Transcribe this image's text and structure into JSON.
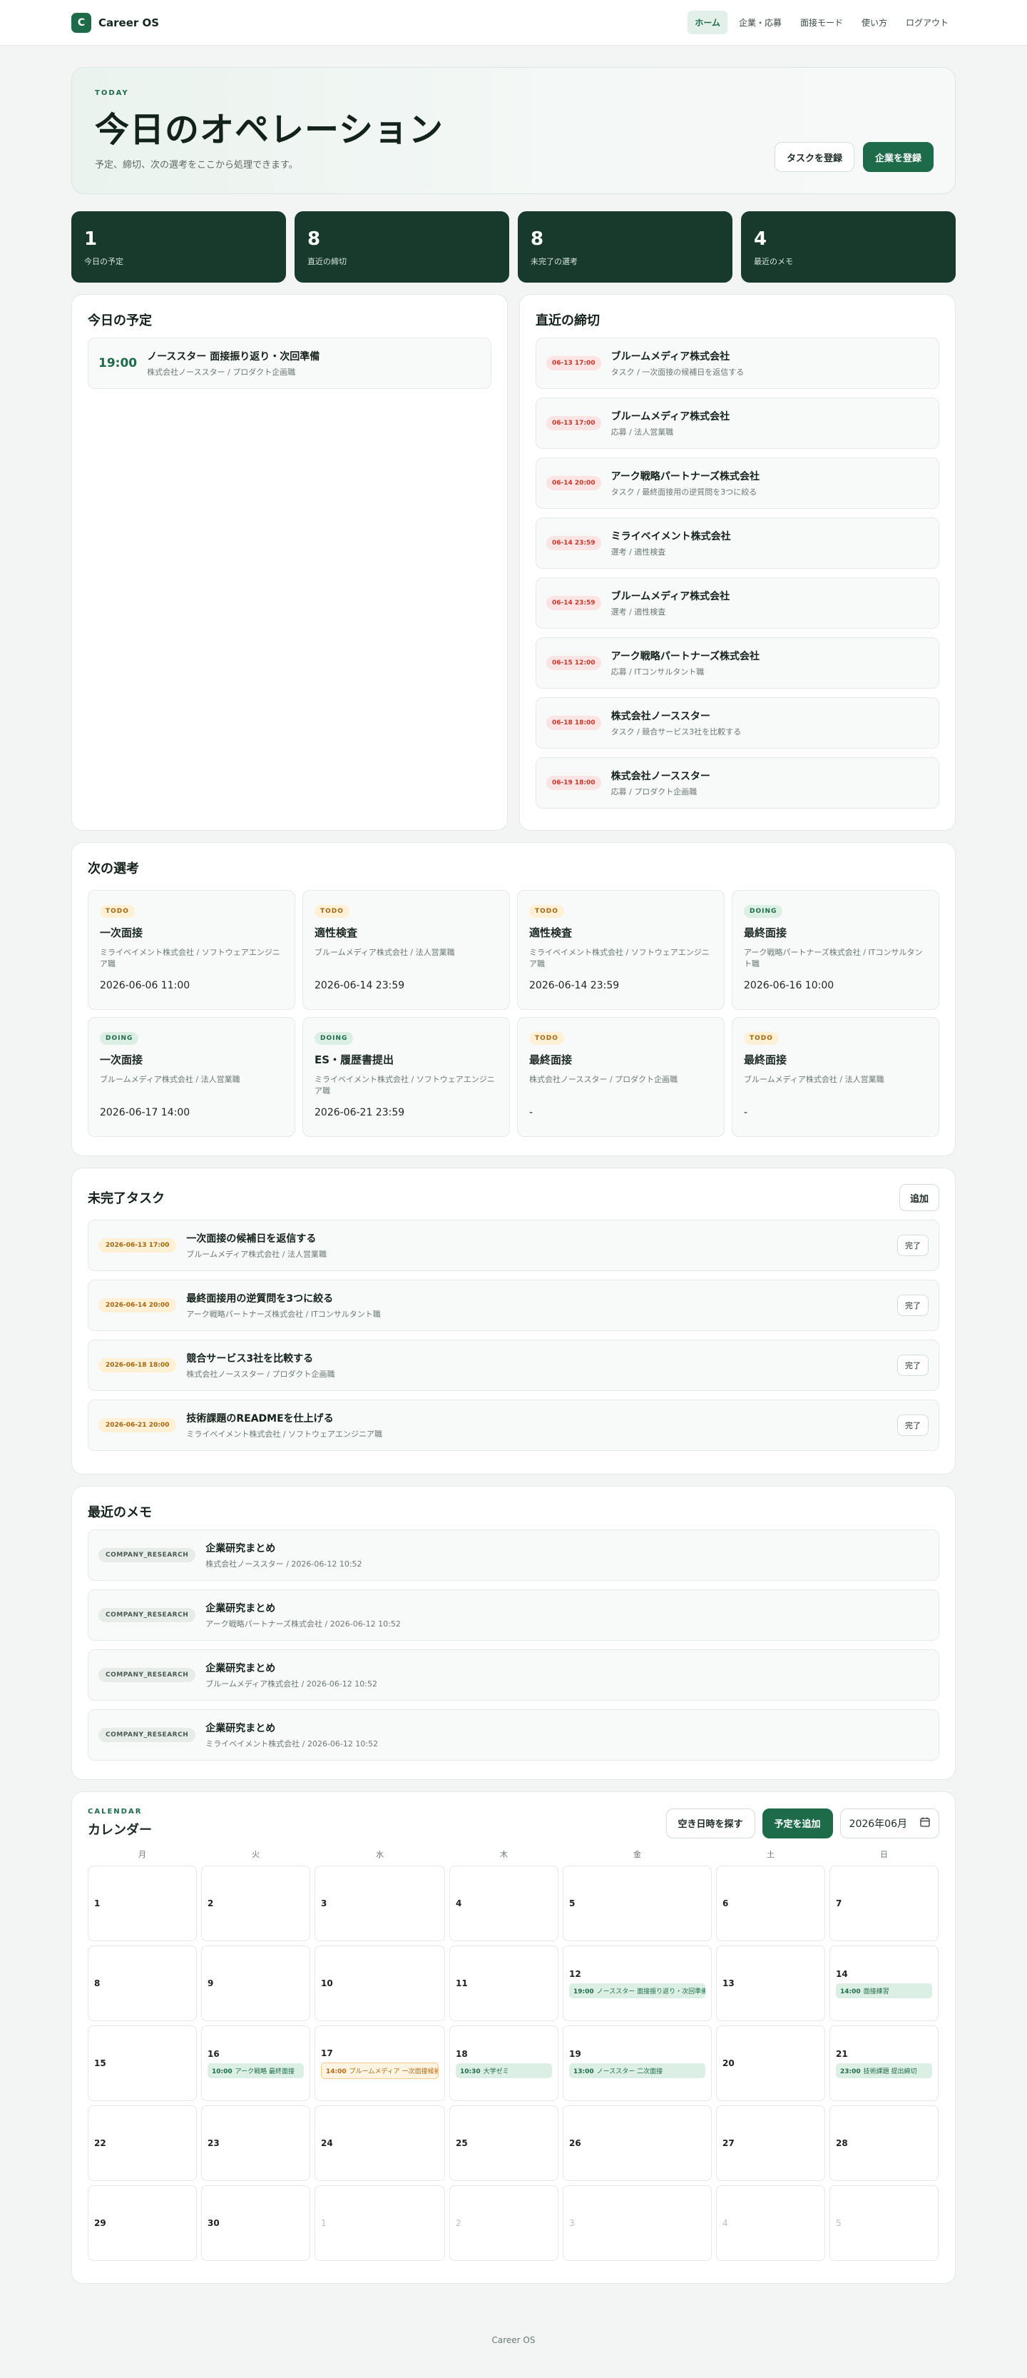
{
  "nav": {
    "logo_letter": "C",
    "brand": "Career OS",
    "links": [
      {
        "label": "ホーム",
        "active": true
      },
      {
        "label": "企業・応募",
        "active": false
      },
      {
        "label": "面接モード",
        "active": false
      },
      {
        "label": "使い方",
        "active": false
      },
      {
        "label": "ログアウト",
        "active": false
      }
    ]
  },
  "hero": {
    "eyebrow": "TODAY",
    "title": "今日のオペレーション",
    "subtitle": "予定、締切、次の選考をここから処理できます。",
    "task_button": "タスクを登録",
    "company_button": "企業を登録"
  },
  "stats": [
    {
      "value": "1",
      "label": "今日の予定"
    },
    {
      "value": "8",
      "label": "直近の締切"
    },
    {
      "value": "8",
      "label": "未完了の選考"
    },
    {
      "value": "4",
      "label": "最近のメモ"
    }
  ],
  "today": {
    "title": "今日の予定",
    "items": [
      {
        "time": "19:00",
        "title": "ノーススター 面接振り返り・次回準備",
        "sub": "株式会社ノーススター / プロダクト企画職"
      }
    ]
  },
  "deadlines": {
    "title": "直近の締切",
    "items": [
      {
        "date": "06-13 17:00",
        "company": "ブルームメディア株式会社",
        "sub": "タスク / 一次面接の候補日を返信する"
      },
      {
        "date": "06-13 17:00",
        "company": "ブルームメディア株式会社",
        "sub": "応募 / 法人営業職"
      },
      {
        "date": "06-14 20:00",
        "company": "アーク戦略パートナーズ株式会社",
        "sub": "タスク / 最終面接用の逆質問を3つに絞る"
      },
      {
        "date": "06-14 23:59",
        "company": "ミライベイメント株式会社",
        "sub": "選考 / 適性検査"
      },
      {
        "date": "06-14 23:59",
        "company": "ブルームメディア株式会社",
        "sub": "選考 / 適性検査"
      },
      {
        "date": "06-15 12:00",
        "company": "アーク戦略パートナーズ株式会社",
        "sub": "応募 / ITコンサルタント職"
      },
      {
        "date": "06-18 18:00",
        "company": "株式会社ノーススター",
        "sub": "タスク / 競合サービス3社を比較する"
      },
      {
        "date": "06-19 18:00",
        "company": "株式会社ノーススター",
        "sub": "応募 / プロダクト企画職"
      }
    ]
  },
  "selections": {
    "title": "次の選考",
    "items": [
      {
        "status": "TODO",
        "name": "一次面接",
        "sub": "ミライベイメント株式会社 / ソフトウェアエンジニア職",
        "date": "2026-06-06 11:00"
      },
      {
        "status": "TODO",
        "name": "適性検査",
        "sub": "ブルームメディア株式会社 / 法人営業職",
        "date": "2026-06-14 23:59"
      },
      {
        "status": "TODO",
        "name": "適性検査",
        "sub": "ミライベイメント株式会社 / ソフトウェアエンジニア職",
        "date": "2026-06-14 23:59"
      },
      {
        "status": "DOING",
        "name": "最終面接",
        "sub": "アーク戦略パートナーズ株式会社 / ITコンサルタント職",
        "date": "2026-06-16 10:00"
      },
      {
        "status": "DOING",
        "name": "一次面接",
        "sub": "ブルームメディア株式会社 / 法人営業職",
        "date": "2026-06-17 14:00"
      },
      {
        "status": "DOING",
        "name": "ES・履歴書提出",
        "sub": "ミライベイメント株式会社 / ソフトウェアエンジニア職",
        "date": "2026-06-21 23:59"
      },
      {
        "status": "TODO",
        "name": "最終面接",
        "sub": "株式会社ノーススター / プロダクト企画職",
        "date": "-"
      },
      {
        "status": "TODO",
        "name": "最終面接",
        "sub": "ブルームメディア株式会社 / 法人営業職",
        "date": "-"
      }
    ]
  },
  "tasks": {
    "title": "未完了タスク",
    "add_button": "追加",
    "done_label": "完了",
    "items": [
      {
        "date": "2026-06-13 17:00",
        "title": "一次面接の候補日を返信する",
        "sub": "ブルームメディア株式会社 / 法人営業職"
      },
      {
        "date": "2026-06-14 20:00",
        "title": "最終面接用の逆質問を3つに絞る",
        "sub": "アーク戦略パートナーズ株式会社 / ITコンサルタント職"
      },
      {
        "date": "2026-06-18 18:00",
        "title": "競合サービス3社を比較する",
        "sub": "株式会社ノーススター / プロダクト企画職"
      },
      {
        "date": "2026-06-21 20:00",
        "title": "技術課題のREADMEを仕上げる",
        "sub": "ミライベイメント株式会社 / ソフトウェアエンジニア職"
      }
    ]
  },
  "memos": {
    "title": "最近のメモ",
    "items": [
      {
        "tag": "COMPANY_RESEARCH",
        "title": "企業研究まとめ",
        "sub": "株式会社ノーススター / 2026-06-12 10:52"
      },
      {
        "tag": "COMPANY_RESEARCH",
        "title": "企業研究まとめ",
        "sub": "アーク戦略パートナーズ株式会社 / 2026-06-12 10:52"
      },
      {
        "tag": "COMPANY_RESEARCH",
        "title": "企業研究まとめ",
        "sub": "ブルームメディア株式会社 / 2026-06-12 10:52"
      },
      {
        "tag": "COMPANY_RESEARCH",
        "title": "企業研究まとめ",
        "sub": "ミライベイメント株式会社 / 2026-06-12 10:52"
      }
    ]
  },
  "calendar": {
    "eyebrow": "CALENDAR",
    "title": "カレンダー",
    "find_button": "空き日時を探す",
    "add_button": "予定を追加",
    "month": "2026年06月",
    "weekdays": [
      "月",
      "火",
      "水",
      "木",
      "金",
      "土",
      "日"
    ],
    "cells": [
      {
        "day": "1"
      },
      {
        "day": "2"
      },
      {
        "day": "3"
      },
      {
        "day": "4"
      },
      {
        "day": "5"
      },
      {
        "day": "6"
      },
      {
        "day": "7"
      },
      {
        "day": "8"
      },
      {
        "day": "9"
      },
      {
        "day": "10"
      },
      {
        "day": "11"
      },
      {
        "day": "12",
        "event": {
          "time": "19:00",
          "text": "ノーススター 面接振り返り・次回準備"
        }
      },
      {
        "day": "13"
      },
      {
        "day": "14",
        "event": {
          "time": "14:00",
          "text": "面接練習"
        }
      },
      {
        "day": "15"
      },
      {
        "day": "16",
        "event": {
          "time": "10:00",
          "text": "アーク戦略 最終面接"
        }
      },
      {
        "day": "17",
        "event": {
          "time": "14:00",
          "text": "ブルームメディア 一次面接候補",
          "warn": true
        }
      },
      {
        "day": "18",
        "event": {
          "time": "10:30",
          "text": "大学ゼミ"
        }
      },
      {
        "day": "19",
        "event": {
          "time": "13:00",
          "text": "ノーススター 二次面接"
        }
      },
      {
        "day": "20"
      },
      {
        "day": "21",
        "event": {
          "time": "23:00",
          "text": "技術課題 提出締切"
        }
      },
      {
        "day": "22"
      },
      {
        "day": "23"
      },
      {
        "day": "24"
      },
      {
        "day": "25"
      },
      {
        "day": "26"
      },
      {
        "day": "27"
      },
      {
        "day": "28"
      },
      {
        "day": "29"
      },
      {
        "day": "30"
      },
      {
        "day": "1",
        "muted": true
      },
      {
        "day": "2",
        "muted": true
      },
      {
        "day": "3",
        "muted": true
      },
      {
        "day": "4",
        "muted": true
      },
      {
        "day": "5",
        "muted": true
      }
    ]
  },
  "footer": "Career OS"
}
